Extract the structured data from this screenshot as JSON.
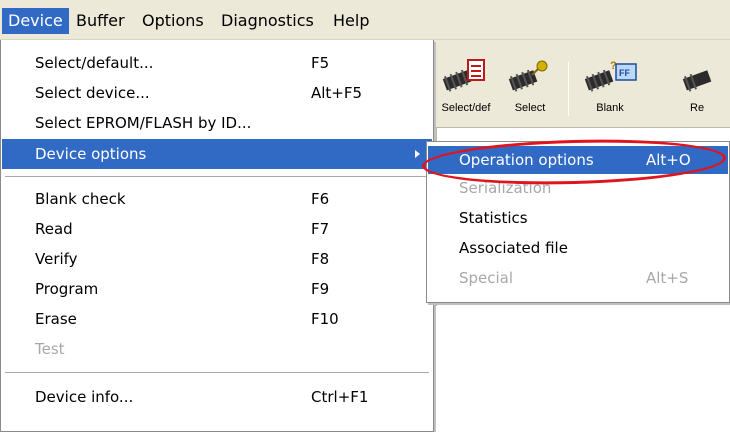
{
  "menubar": {
    "items": [
      {
        "label": "Device",
        "active": true
      },
      {
        "label": "Buffer"
      },
      {
        "label": "Options"
      },
      {
        "label": "Diagnostics"
      },
      {
        "label": "Help"
      }
    ]
  },
  "toolbar": {
    "buttons": [
      {
        "label": "Select/def",
        "icon": "chip-with-list-icon"
      },
      {
        "label": "Select",
        "icon": "chip-with-key-icon"
      },
      {
        "label": "Blank",
        "icon": "chip-blank-check-icon"
      },
      {
        "label": "Re",
        "icon": "chip-read-icon"
      }
    ]
  },
  "device_menu": {
    "items": [
      {
        "label": "Select/default...",
        "shortcut": "F5"
      },
      {
        "label": "Select device...",
        "shortcut": "Alt+F5"
      },
      {
        "label": "Select EPROM/FLASH by ID...",
        "shortcut": ""
      },
      {
        "label": "Device options",
        "shortcut": "",
        "highlighted": true,
        "submenu": true
      },
      {
        "label": "Blank check",
        "shortcut": "F6"
      },
      {
        "label": "Read",
        "shortcut": "F7"
      },
      {
        "label": "Verify",
        "shortcut": "F8"
      },
      {
        "label": "Program",
        "shortcut": "F9"
      },
      {
        "label": "Erase",
        "shortcut": "F10"
      },
      {
        "label": "Test",
        "shortcut": "",
        "disabled": true
      },
      {
        "label": "Device info...",
        "shortcut": "Ctrl+F1"
      }
    ]
  },
  "device_options_submenu": {
    "items": [
      {
        "label": "Operation options",
        "shortcut": "Alt+O",
        "highlighted": true
      },
      {
        "label": "Serialization",
        "shortcut": "",
        "disabled": true
      },
      {
        "label": "Statistics",
        "shortcut": ""
      },
      {
        "label": "Associated file",
        "shortcut": ""
      },
      {
        "label": "Special",
        "shortcut": "Alt+S",
        "disabled": true
      }
    ]
  },
  "colors": {
    "highlight": "#316ac5",
    "menubar_bg": "#ece9d8",
    "disabled_text": "#a8a8a8",
    "annotation_circle": "#e0141e"
  }
}
